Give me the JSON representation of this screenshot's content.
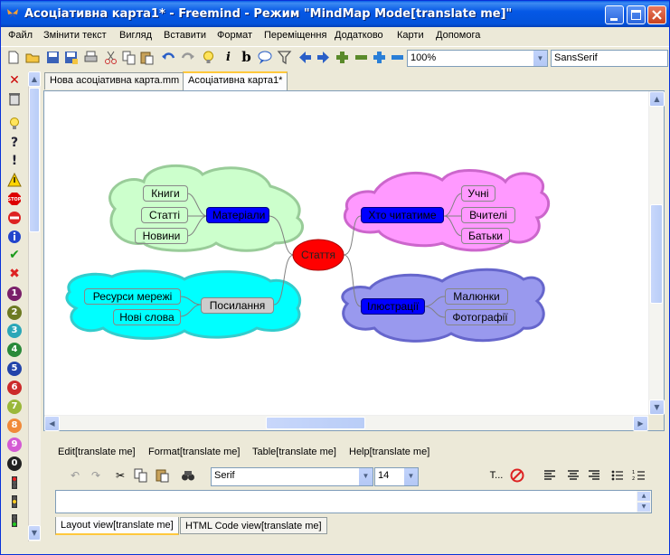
{
  "window": {
    "title": "Асоціативна карта1* - Freemind - Режим \"MindMap Mode[translate me]\""
  },
  "menu": [
    "Файл",
    "Змінити текст",
    "Вигляд",
    "Вставити",
    "Формат",
    "Переміщення",
    "Додатково",
    "Карти",
    "Допомога"
  ],
  "toolbar": {
    "zoom": "100%",
    "font": "SansSerif"
  },
  "tabs": [
    "Нова асоціативна карта.mm",
    "Асоціативна карта1*"
  ],
  "left_icon_numbers": [
    "1",
    "2",
    "3",
    "4",
    "5",
    "6",
    "7",
    "8",
    "9",
    "0"
  ],
  "map": {
    "center": "Стаття",
    "branches": {
      "materials": {
        "label": "Матеріали",
        "children": [
          "Книги",
          "Статті",
          "Новини"
        ]
      },
      "links": {
        "label": "Посилання",
        "children": [
          "Ресурси мережі",
          "Нові слова"
        ]
      },
      "readers": {
        "label": "Хто читатиме",
        "children": [
          "Учні",
          "Вчителі",
          "Батьки"
        ]
      },
      "illustrations": {
        "label": "Ілюстрації",
        "children": [
          "Малюнки",
          "Фотографії"
        ]
      }
    },
    "colors": {
      "center": "#ff0000",
      "green_cloud": "#ccffcc",
      "cyan_cloud": "#00ffff",
      "pink_cloud": "#ff99ff",
      "blue_cloud": "#9999ee",
      "selected_node": "#0000ff"
    }
  },
  "editor": {
    "menu": [
      "Edit[translate me]",
      "Format[translate me]",
      "Table[translate me]",
      "Help[translate me]"
    ],
    "font": "Serif",
    "size": "14",
    "tabs": [
      "Layout view[translate me]",
      "HTML Code view[translate me]"
    ]
  }
}
